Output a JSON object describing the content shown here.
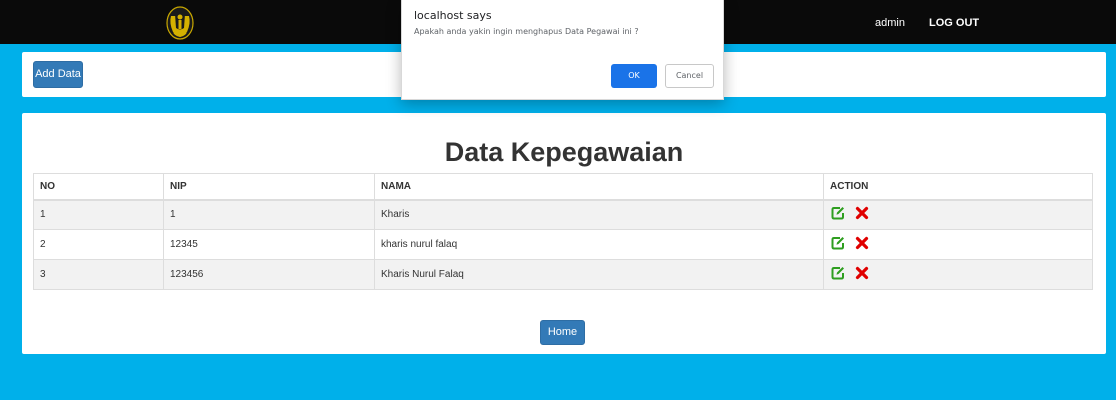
{
  "navbar": {
    "logo_icon": "emblem-logo-icon",
    "user_label": "admin",
    "logout_label": "LOG OUT"
  },
  "toolbar": {
    "add_label": "Add Data"
  },
  "dialog": {
    "title": "localhost says",
    "message": "Apakah anda yakin ingin menghapus Data Pegawai ini ?",
    "ok_label": "OK",
    "cancel_label": "Cancel"
  },
  "main": {
    "title": "Data Kepegawaian",
    "table": {
      "headers": [
        "NO",
        "NIP",
        "NAMA",
        "ACTION"
      ],
      "rows": [
        {
          "no": "1",
          "nip": "1",
          "nama": "Kharis"
        },
        {
          "no": "2",
          "nip": "12345",
          "nama": "kharis nurul falaq"
        },
        {
          "no": "3",
          "nip": "123456",
          "nama": "Kharis Nurul Falaq"
        }
      ],
      "edit_icon": "edit-icon",
      "delete_icon": "delete-icon"
    },
    "home_label": "Home"
  },
  "colors": {
    "page_background": "#00b0ea",
    "navbar": "#0a0a0a",
    "primary_button": "#337ab7",
    "dialog_ok": "#1a73e8",
    "edit_icon": "#2e9e1f",
    "delete_icon": "#e00000"
  }
}
